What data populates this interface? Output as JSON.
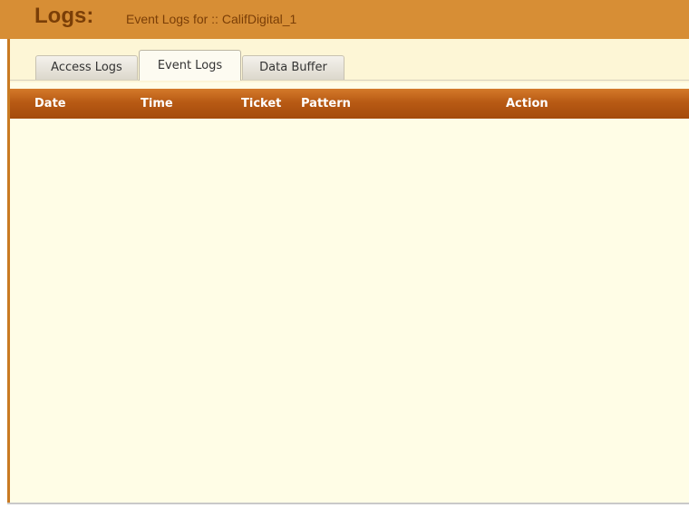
{
  "header": {
    "title": "Logs:",
    "subtitle": "Event Logs for ::  CalifDigital_1"
  },
  "tabs": [
    {
      "label": "Access Logs",
      "active": false
    },
    {
      "label": "Event Logs",
      "active": true
    },
    {
      "label": "Data Buffer",
      "active": false
    }
  ],
  "table": {
    "columns": [
      "Date",
      "Time",
      "Ticket",
      "Pattern",
      "Action"
    ],
    "rows": []
  },
  "colors": {
    "header_bg": "#d78e35",
    "header_text": "#7a3e07",
    "panel_bg": "#fffde6",
    "table_header_bg": "#b85a14"
  }
}
